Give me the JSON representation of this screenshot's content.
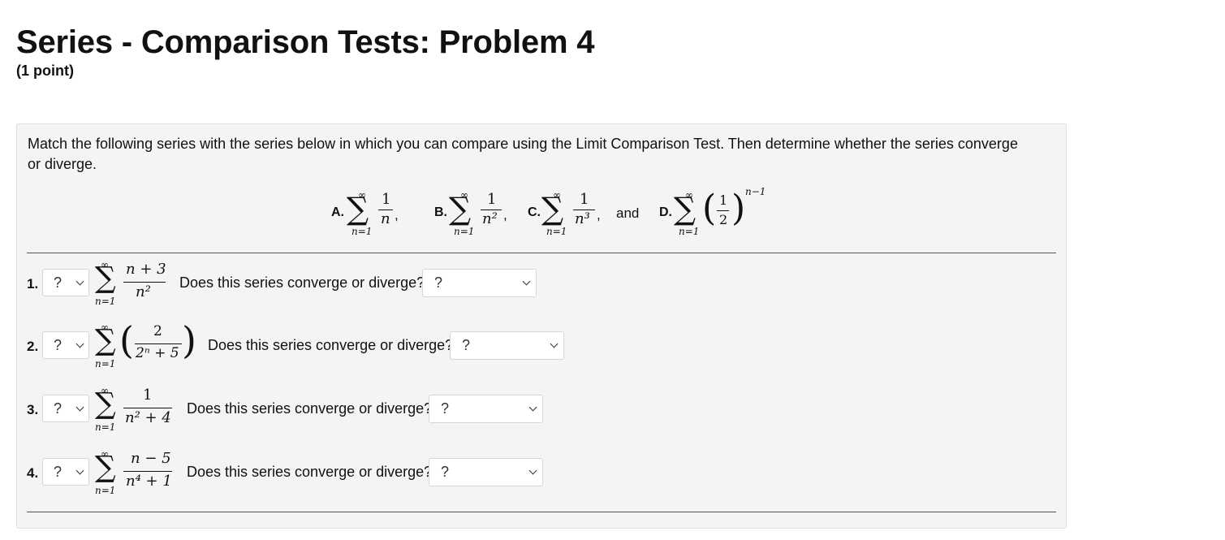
{
  "header": {
    "title": "Series - Comparison Tests: Problem 4",
    "points": "(1 point)"
  },
  "instructions": "Match the following series with the series below in which you can compare using the Limit Comparison Test. Then determine whether the series converge or diverge.",
  "choices": {
    "and_word": "and",
    "items": [
      {
        "letter": "A.",
        "numerator": "1",
        "denominator": "n",
        "lower": "n=1",
        "upper": "∞"
      },
      {
        "letter": "B.",
        "numerator": "1",
        "denominator": "n²",
        "lower": "n=1",
        "upper": "∞"
      },
      {
        "letter": "C.",
        "numerator": "1",
        "denominator": "n³",
        "lower": "n=1",
        "upper": "∞"
      },
      {
        "letter": "D.",
        "numerator": "1",
        "denominator": "2",
        "exponent": "n−1",
        "lower": "n=1",
        "upper": "∞"
      }
    ]
  },
  "problems": [
    {
      "number": "1.",
      "match_value": "?",
      "numerator": "n + 3",
      "denominator": "n²",
      "question": "Does this series converge or diverge?",
      "answer_value": "?",
      "lower": "n=1",
      "upper": "∞"
    },
    {
      "number": "2.",
      "match_value": "?",
      "numerator": "2",
      "denominator": "2ⁿ + 5",
      "question": "Does this series converge or diverge?",
      "answer_value": "?",
      "lower": "n=1",
      "upper": "∞"
    },
    {
      "number": "3.",
      "match_value": "?",
      "numerator": "1",
      "denominator": "n² + 4",
      "question": "Does this series converge or diverge?",
      "answer_value": "?",
      "lower": "n=1",
      "upper": "∞"
    },
    {
      "number": "4.",
      "match_value": "?",
      "numerator": "n − 5",
      "denominator": "n⁴ + 1",
      "question": "Does this series converge or diverge?",
      "answer_value": "?",
      "lower": "n=1",
      "upper": "∞"
    }
  ]
}
